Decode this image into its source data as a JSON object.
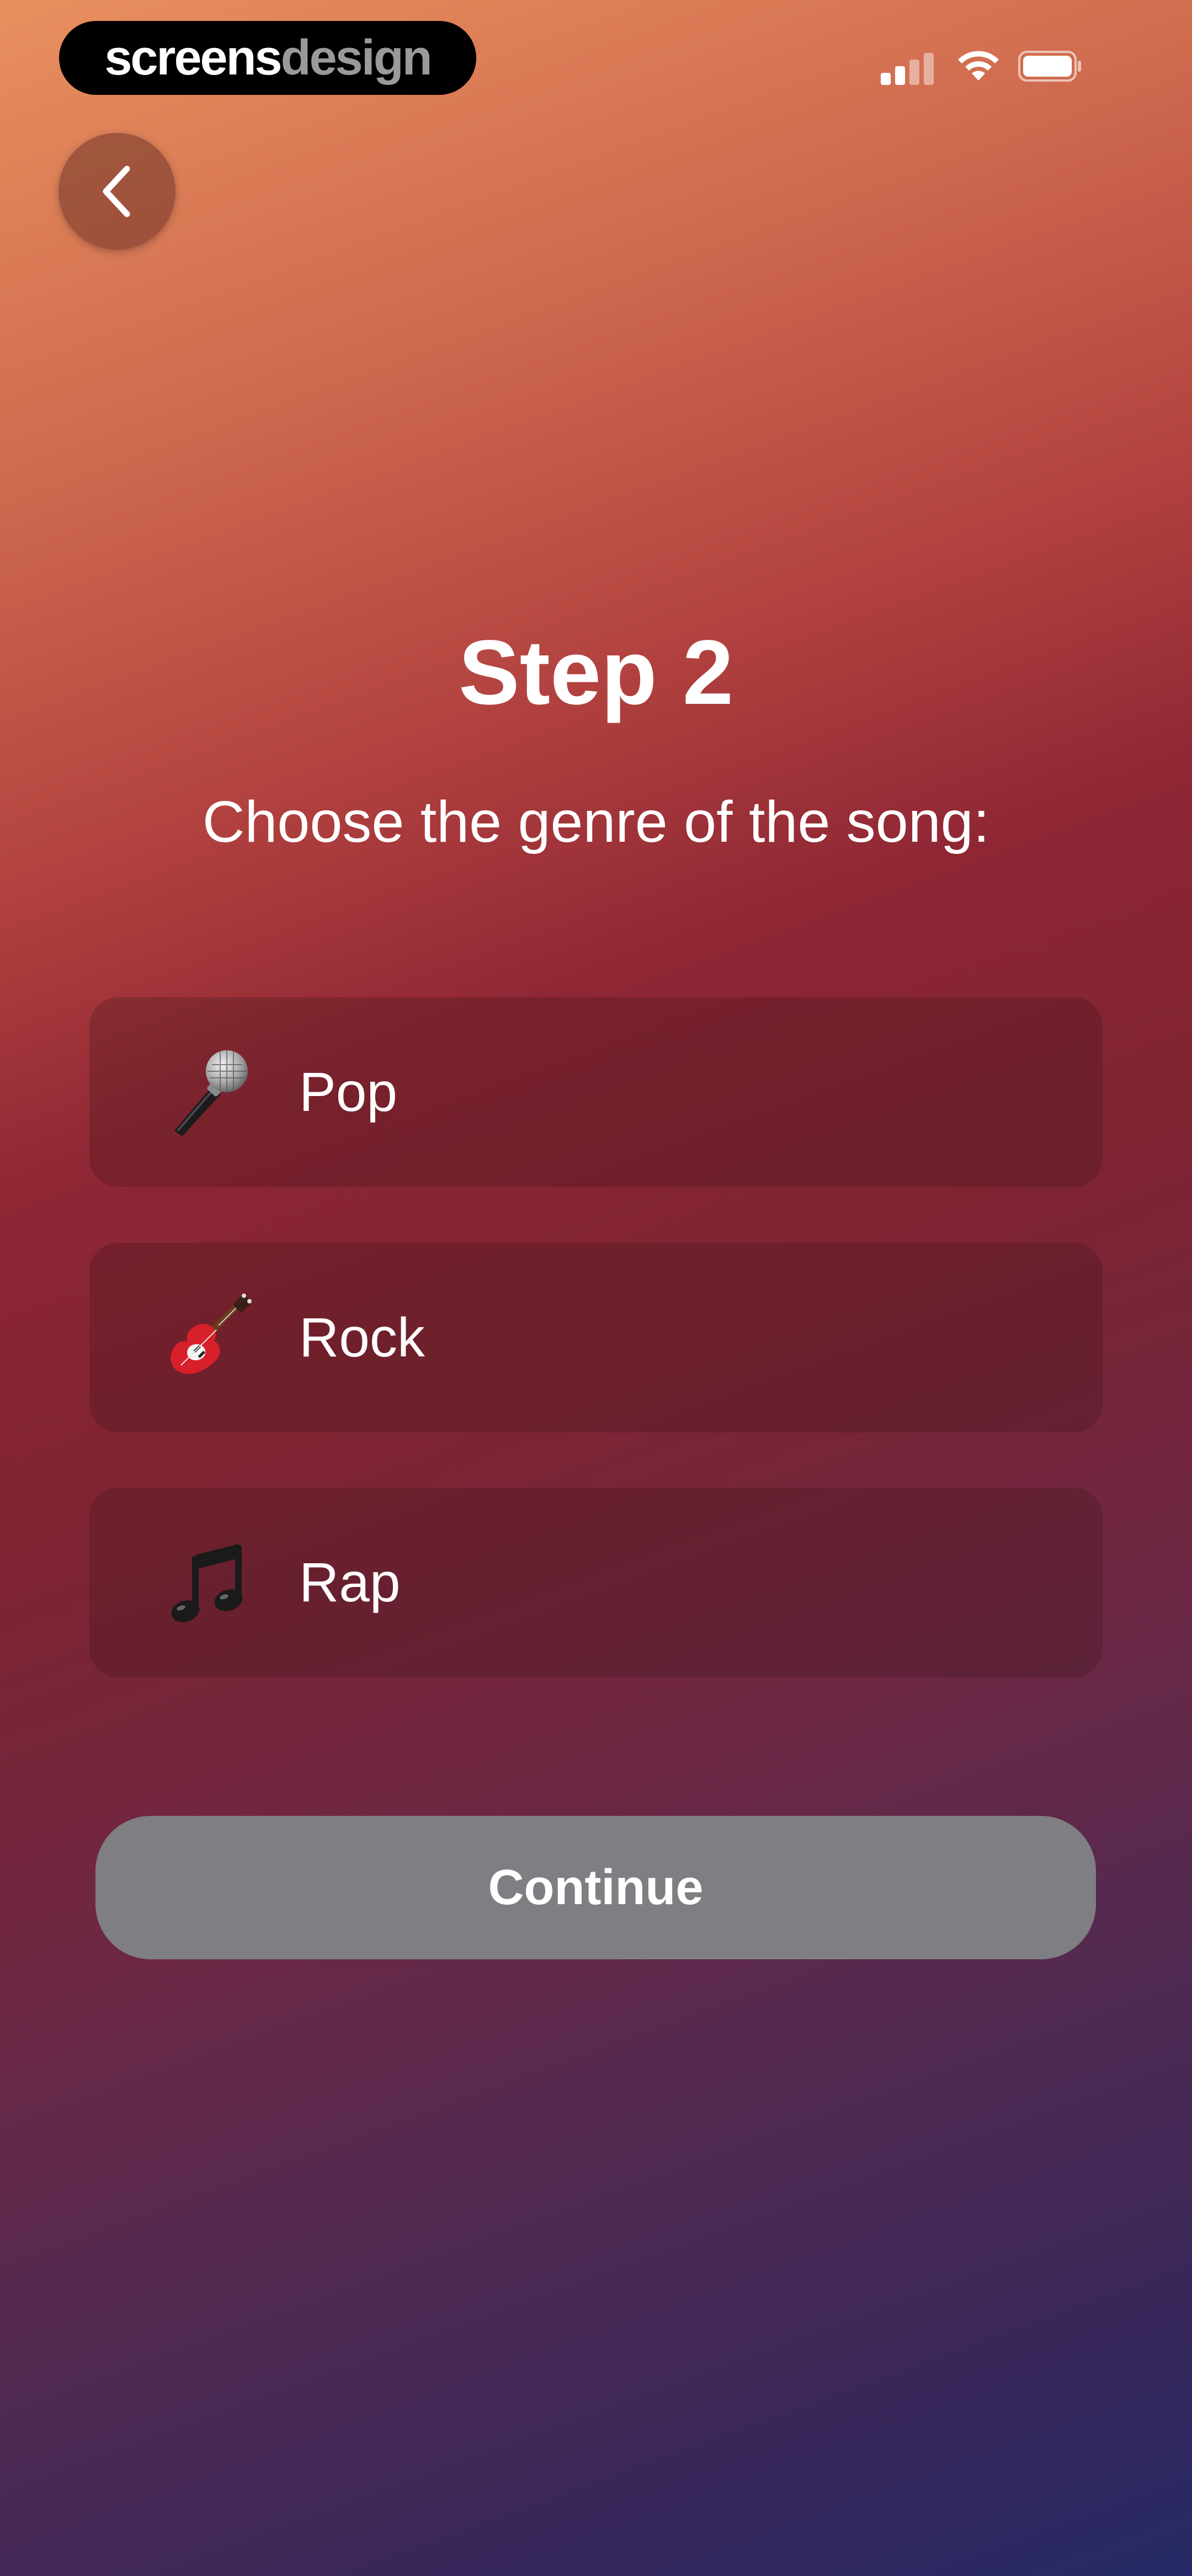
{
  "brand": {
    "word_a": "screens",
    "word_b": "design"
  },
  "status_bar": {
    "signal_icon": "cellular-signal-icon",
    "wifi_icon": "wifi-icon",
    "battery_icon": "battery-icon"
  },
  "nav": {
    "back_icon": "chevron-left-icon"
  },
  "header": {
    "title": "Step 2",
    "subtitle": "Choose the genre of the song:"
  },
  "genres": [
    {
      "label": "Pop",
      "icon": "microphone-icon"
    },
    {
      "label": "Rock",
      "icon": "guitar-icon"
    },
    {
      "label": "Rap",
      "icon": "music-notes-icon"
    }
  ],
  "continue_button": {
    "label": "Continue",
    "color": "#7f7e82"
  },
  "colors": {
    "gradient_top": "#e8905e",
    "gradient_mid": "#8e2634",
    "gradient_bottom": "#262a66"
  }
}
